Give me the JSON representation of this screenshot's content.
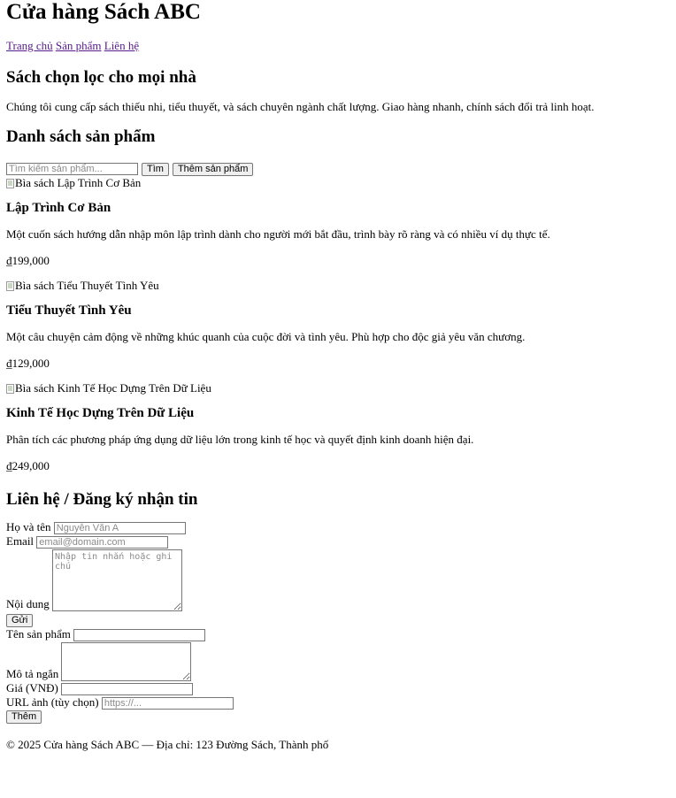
{
  "header": {
    "title": "Cửa hàng Sách ABC"
  },
  "nav": [
    {
      "label": "Trang chủ"
    },
    {
      "label": "Sản phẩm"
    },
    {
      "label": "Liên hệ"
    }
  ],
  "hero": {
    "heading": "Sách chọn lọc cho mọi nhà",
    "text": "Chúng tôi cung cấp sách thiếu nhi, tiểu thuyết, và sách chuyên ngành chất lượng. Giao hàng nhanh, chính sách đổi trả linh hoạt."
  },
  "products": {
    "heading": "Danh sách sản phẩm",
    "search_placeholder": "Tìm kiếm sản phẩm...",
    "search_button": "Tìm",
    "add_button": "Thêm sản phẩm",
    "items": [
      {
        "img_alt": "Bìa sách Lập Trình Cơ Bản",
        "title": "Lập Trình Cơ Bản",
        "desc": "Một cuốn sách hướng dẫn nhập môn lập trình dành cho người mới bắt đầu, trình bày rõ ràng và có nhiều ví dụ thực tế.",
        "price": "₫199,000"
      },
      {
        "img_alt": "Bìa sách Tiểu Thuyết Tình Yêu",
        "title": "Tiểu Thuyết Tình Yêu",
        "desc": "Một câu chuyện cảm động về những khúc quanh của cuộc đời và tình yêu. Phù hợp cho độc giả yêu văn chương.",
        "price": "₫129,000"
      },
      {
        "img_alt": "Bìa sách Kinh Tế Học Dựng Trên Dữ Liệu",
        "title": "Kinh Tế Học Dựng Trên Dữ Liệu",
        "desc": "Phân tích các phương pháp ứng dụng dữ liệu lớn trong kinh tế học và quyết định kinh doanh hiện đại.",
        "price": "₫249,000"
      }
    ]
  },
  "contact": {
    "heading": "Liên hệ / Đăng ký nhận tin",
    "name_label": "Họ và tên",
    "name_placeholder": "Nguyễn Văn A",
    "email_label": "Email",
    "email_placeholder": "email@domain.com",
    "message_label": "Nội dung",
    "message_placeholder": "Nhập tin nhắn hoặc ghi chú",
    "submit": "Gửi"
  },
  "add_product": {
    "name_label": "Tên sản phẩm",
    "desc_label": "Mô tả ngắn",
    "price_label": "Giá (VNĐ)",
    "url_label": "URL ảnh (tùy chọn)",
    "url_placeholder": "https://...",
    "submit": "Thêm"
  },
  "footer": {
    "text": "© 2025 Cửa hàng Sách ABC — Địa chỉ: 123 Đường Sách, Thành phố"
  }
}
